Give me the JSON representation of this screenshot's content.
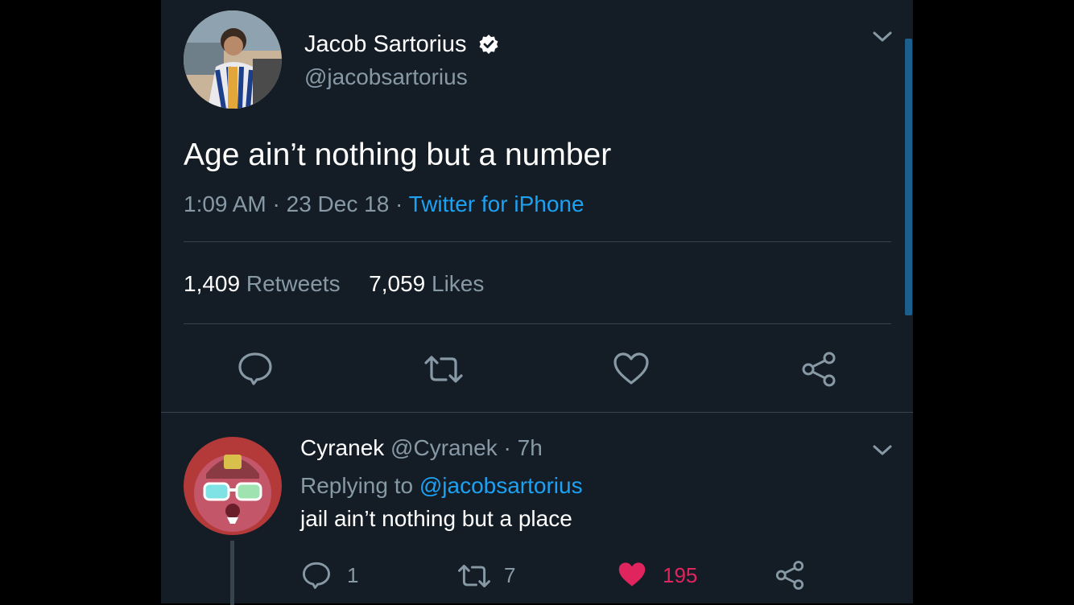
{
  "tweet": {
    "author_name": "Jacob Sartorius",
    "author_handle": "@jacobsartorius",
    "text": "Age ain’t nothing but a number",
    "time": "1:09 AM",
    "date": "23 Dec 18",
    "source": "Twitter for iPhone",
    "sep": "·",
    "retweets_count": "1,409",
    "retweets_label": "Retweets",
    "likes_count": "7,059",
    "likes_label": "Likes"
  },
  "reply": {
    "author_name": "Cyranek",
    "author_handle": "@Cyranek",
    "age": "7h",
    "sep": "·",
    "replying_prefix": "Replying to",
    "replying_to": "@jacobsartorius",
    "text": "jail ain’t nothing but a place",
    "reply_count": "1",
    "retweet_count": "7",
    "like_count": "195"
  },
  "colors": {
    "background": "#141d26",
    "accent": "#1da1f2",
    "muted": "#8899a6",
    "like_red": "#e0245e"
  },
  "icons": [
    "verified-badge-icon",
    "chevron-down-icon",
    "reply-icon",
    "retweet-icon",
    "like-icon",
    "share-icon"
  ]
}
